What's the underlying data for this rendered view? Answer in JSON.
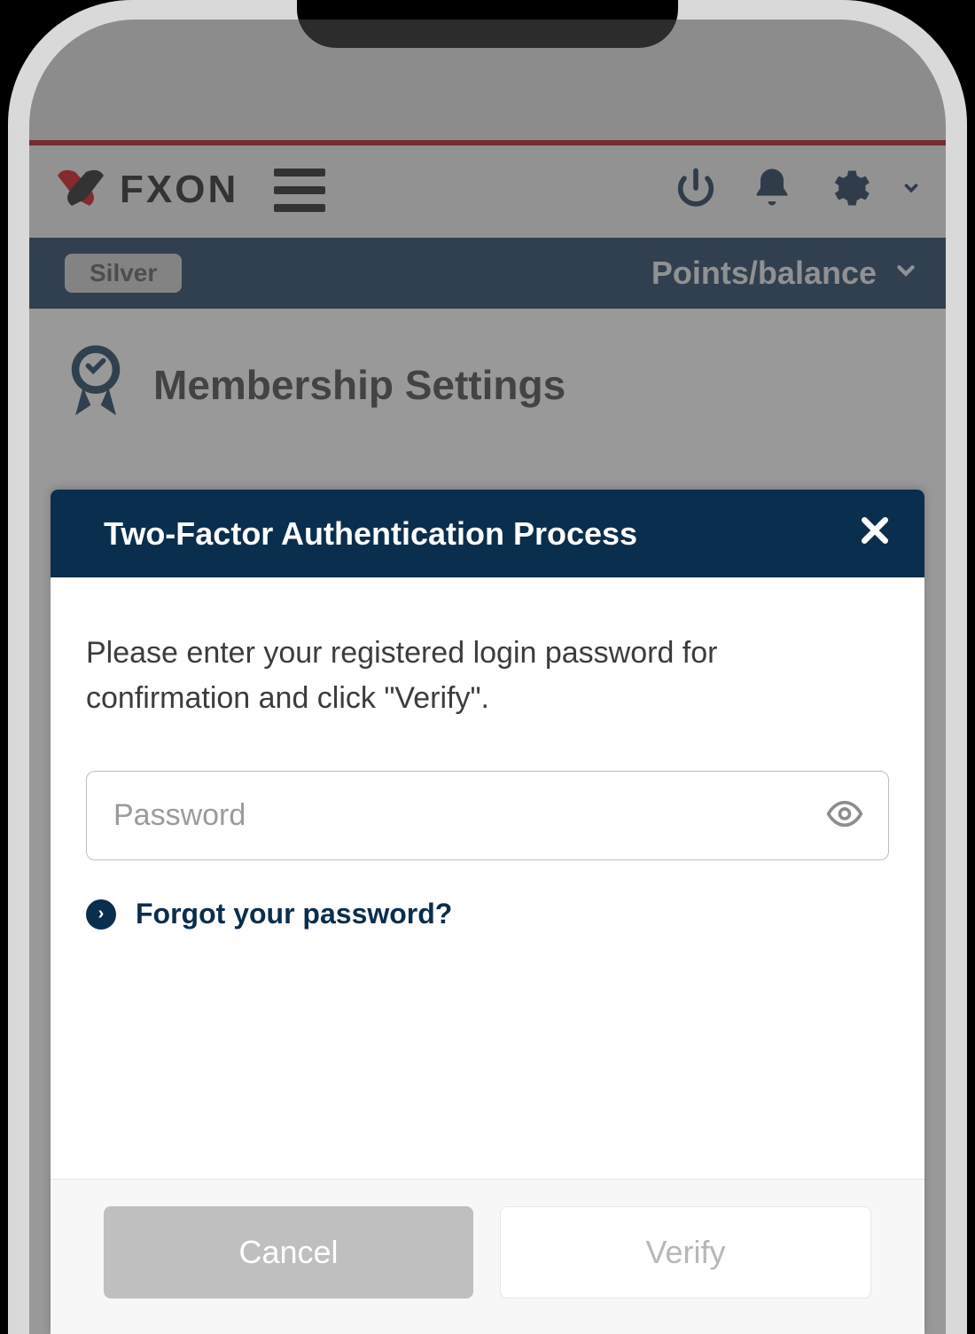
{
  "brand": "FXON",
  "statusbar": {
    "tier": "Silver",
    "points_label": "Points/balance"
  },
  "page": {
    "title": "Membership Settings"
  },
  "modal": {
    "title": "Two-Factor Authentication Process",
    "description": "Please enter your registered login password for confirmation and click \"Verify\".",
    "password_placeholder": "Password",
    "forgot_link": "Forgot your password?",
    "cancel_label": "Cancel",
    "verify_label": "Verify"
  }
}
